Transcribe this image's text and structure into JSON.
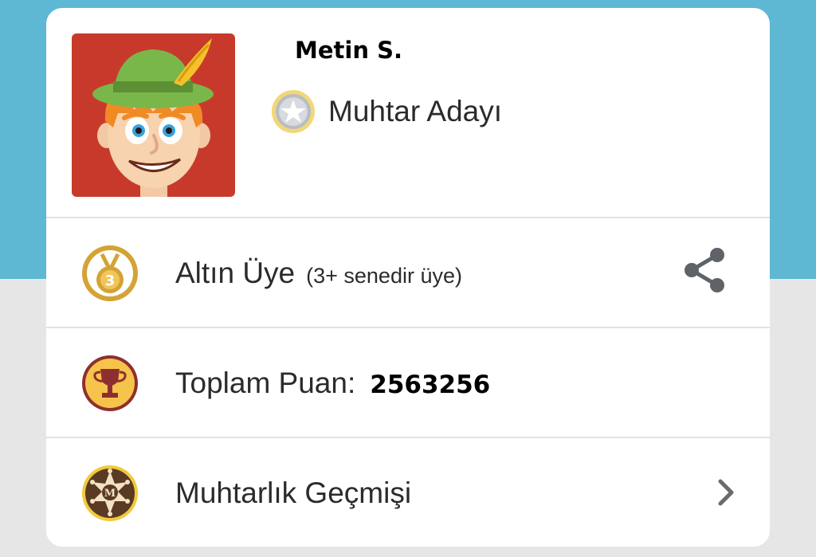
{
  "profile": {
    "name": "Metin S.",
    "rank": "Muhtar Adayı"
  },
  "membership": {
    "label": "Altın Üye",
    "detail": "(3+ senedir üye)",
    "badge_number": "3",
    "share_icon": "share-icon"
  },
  "points": {
    "label": "Toplam Puan:",
    "value": "2563256"
  },
  "history": {
    "label": "Muhtarlık Geçmişi",
    "badge_letter": "M",
    "chevron_icon": "chevron-right-icon"
  },
  "colors": {
    "header_blue": "#5eb7d3",
    "page_gray": "#e6e6e6",
    "avatar_red": "#c73a2b",
    "gold": "#d4a335",
    "trophy_ring": "#8e2f2f",
    "sheriff_brown": "#5a3a22"
  }
}
